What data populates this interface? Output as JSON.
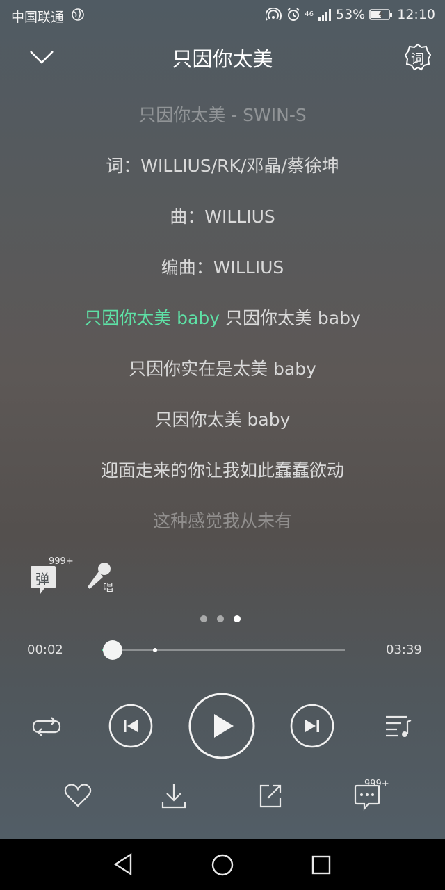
{
  "status_bar": {
    "carrier": "中国联通",
    "signal_label": "46",
    "battery": "53%",
    "time": "12:10"
  },
  "header": {
    "title": "只因你太美",
    "icons": [
      "chevron-down-icon",
      "lyrics-settings-icon"
    ],
    "lyric_icon_char": "词"
  },
  "lyrics": {
    "lines": [
      "只因你太美 - SWIN-S",
      "词：WILLIUS/RK/邓晶/蔡徐坤",
      "曲：WILLIUS",
      "编曲：WILLIUS",
      "只因你太美 baby 只因你太美 baby",
      "只因你实在是太美 baby",
      "只因你太美 baby",
      "迎面走来的你让我如此蠢蠢欲动",
      "这种感觉我从未有"
    ],
    "current_highlight": "只因你太美 baby",
    "current_rest": " 只因你太美 baby"
  },
  "tools": {
    "danmu_char": "弹",
    "danmu_count": "999+",
    "sing_char": "唱"
  },
  "pager": {
    "count": 3,
    "active_index": 2
  },
  "progress": {
    "elapsed": "00:02",
    "total": "03:39",
    "played_fraction": 0.01,
    "buffered_fraction": 0.22
  },
  "controls": {
    "icons": [
      "repeat-icon",
      "previous-icon",
      "play-icon",
      "next-icon",
      "playlist-icon"
    ]
  },
  "actions": {
    "icons": [
      "heart-icon",
      "download-icon",
      "share-icon",
      "comment-icon"
    ],
    "comment_count": "999+"
  },
  "colors": {
    "accent": "#5ee1a6",
    "navbar": "#000000"
  }
}
